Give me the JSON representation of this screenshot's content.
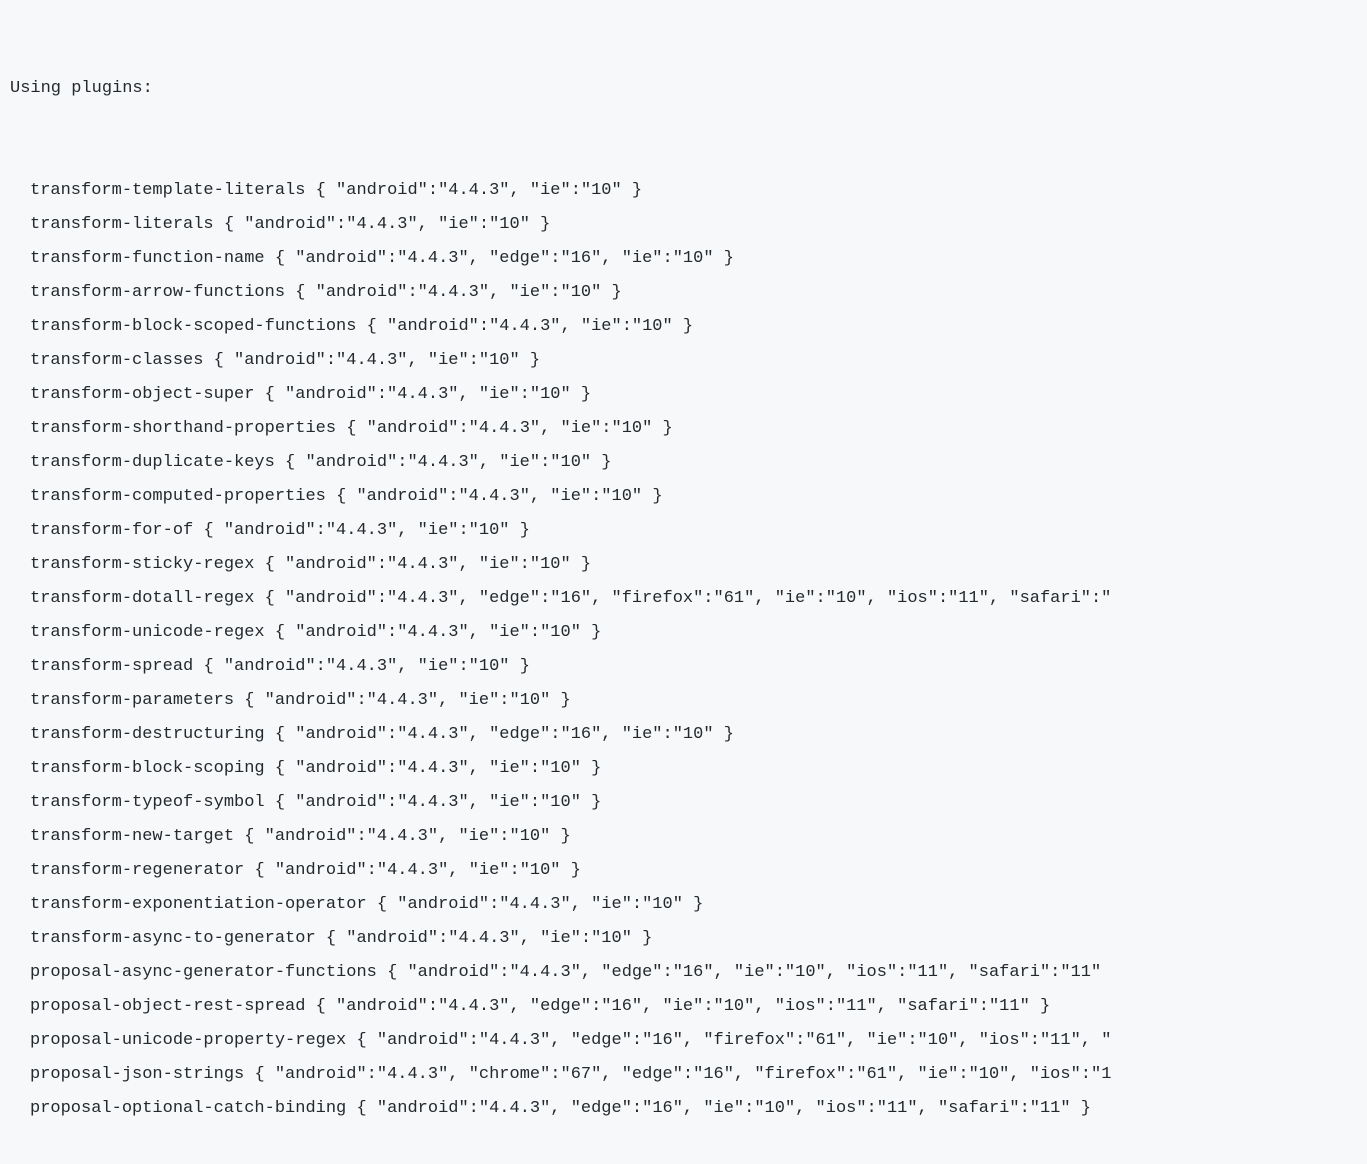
{
  "header": "Using plugins:",
  "plugins": [
    {
      "name": "transform-template-literals",
      "targets": "{ \"android\":\"4.4.3\", \"ie\":\"10\" }"
    },
    {
      "name": "transform-literals",
      "targets": "{ \"android\":\"4.4.3\", \"ie\":\"10\" }"
    },
    {
      "name": "transform-function-name",
      "targets": "{ \"android\":\"4.4.3\", \"edge\":\"16\", \"ie\":\"10\" }"
    },
    {
      "name": "transform-arrow-functions",
      "targets": "{ \"android\":\"4.4.3\", \"ie\":\"10\" }"
    },
    {
      "name": "transform-block-scoped-functions",
      "targets": "{ \"android\":\"4.4.3\", \"ie\":\"10\" }"
    },
    {
      "name": "transform-classes",
      "targets": "{ \"android\":\"4.4.3\", \"ie\":\"10\" }"
    },
    {
      "name": "transform-object-super",
      "targets": "{ \"android\":\"4.4.3\", \"ie\":\"10\" }"
    },
    {
      "name": "transform-shorthand-properties",
      "targets": "{ \"android\":\"4.4.3\", \"ie\":\"10\" }"
    },
    {
      "name": "transform-duplicate-keys",
      "targets": "{ \"android\":\"4.4.3\", \"ie\":\"10\" }"
    },
    {
      "name": "transform-computed-properties",
      "targets": "{ \"android\":\"4.4.3\", \"ie\":\"10\" }"
    },
    {
      "name": "transform-for-of",
      "targets": "{ \"android\":\"4.4.3\", \"ie\":\"10\" }"
    },
    {
      "name": "transform-sticky-regex",
      "targets": "{ \"android\":\"4.4.3\", \"ie\":\"10\" }"
    },
    {
      "name": "transform-dotall-regex",
      "targets": "{ \"android\":\"4.4.3\", \"edge\":\"16\", \"firefox\":\"61\", \"ie\":\"10\", \"ios\":\"11\", \"safari\":\""
    },
    {
      "name": "transform-unicode-regex",
      "targets": "{ \"android\":\"4.4.3\", \"ie\":\"10\" }"
    },
    {
      "name": "transform-spread",
      "targets": "{ \"android\":\"4.4.3\", \"ie\":\"10\" }"
    },
    {
      "name": "transform-parameters",
      "targets": "{ \"android\":\"4.4.3\", \"ie\":\"10\" }"
    },
    {
      "name": "transform-destructuring",
      "targets": "{ \"android\":\"4.4.3\", \"edge\":\"16\", \"ie\":\"10\" }"
    },
    {
      "name": "transform-block-scoping",
      "targets": "{ \"android\":\"4.4.3\", \"ie\":\"10\" }"
    },
    {
      "name": "transform-typeof-symbol",
      "targets": "{ \"android\":\"4.4.3\", \"ie\":\"10\" }"
    },
    {
      "name": "transform-new-target",
      "targets": "{ \"android\":\"4.4.3\", \"ie\":\"10\" }"
    },
    {
      "name": "transform-regenerator",
      "targets": "{ \"android\":\"4.4.3\", \"ie\":\"10\" }"
    },
    {
      "name": "transform-exponentiation-operator",
      "targets": "{ \"android\":\"4.4.3\", \"ie\":\"10\" }"
    },
    {
      "name": "transform-async-to-generator",
      "targets": "{ \"android\":\"4.4.3\", \"ie\":\"10\" }"
    },
    {
      "name": "proposal-async-generator-functions",
      "targets": "{ \"android\":\"4.4.3\", \"edge\":\"16\", \"ie\":\"10\", \"ios\":\"11\", \"safari\":\"11\""
    },
    {
      "name": "proposal-object-rest-spread",
      "targets": "{ \"android\":\"4.4.3\", \"edge\":\"16\", \"ie\":\"10\", \"ios\":\"11\", \"safari\":\"11\" }"
    },
    {
      "name": "proposal-unicode-property-regex",
      "targets": "{ \"android\":\"4.4.3\", \"edge\":\"16\", \"firefox\":\"61\", \"ie\":\"10\", \"ios\":\"11\", \""
    },
    {
      "name": "proposal-json-strings",
      "targets": "{ \"android\":\"4.4.3\", \"chrome\":\"67\", \"edge\":\"16\", \"firefox\":\"61\", \"ie\":\"10\", \"ios\":\"1"
    },
    {
      "name": "proposal-optional-catch-binding",
      "targets": "{ \"android\":\"4.4.3\", \"edge\":\"16\", \"ie\":\"10\", \"ios\":\"11\", \"safari\":\"11\" }"
    }
  ]
}
